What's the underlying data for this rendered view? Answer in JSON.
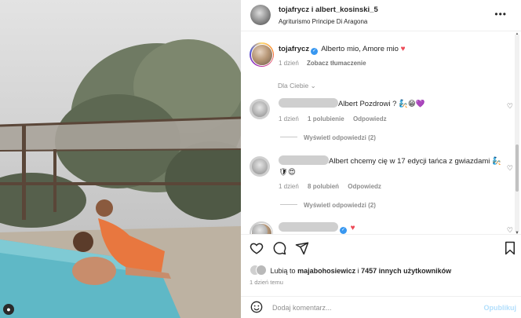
{
  "post": {
    "author_header": "tojafrycz i albert_kosinski_5",
    "location": "Agriturismo Principe Di Aragona",
    "more_label": "•••"
  },
  "caption": {
    "username": "tojafrycz",
    "text": "Alberto mio, Amore mio",
    "heart": "♥",
    "time": "1 dzień",
    "translate_label": "Zobacz tłumaczenie"
  },
  "sort_label": "Dla Ciebie",
  "comments": [
    {
      "text": "Albert Pozdrowi ?",
      "emoji": "🧞😁💜",
      "time": "1 dzień",
      "likes": "1 polubienie",
      "reply_label": "Odpowiedz",
      "replies_label": "Wyświetl odpowiedzi (2)"
    },
    {
      "text": "Albert chcemy cię w 17 edycji tańca z gwiazdami",
      "emoji": "🧞🛡😍",
      "time": "1 dzień",
      "likes": "8 polubień",
      "reply_label": "Odpowiedz",
      "replies_label": "Wyświetl odpowiedzi (2)"
    },
    {
      "heart": "♥"
    }
  ],
  "likes_summary": {
    "prefix": "Lubią to",
    "user": "majabohosiewicz",
    "middle": "i",
    "count": "7457 innych użytkowników"
  },
  "post_date": "1 dzień temu",
  "comment_box": {
    "placeholder": "Dodaj komentarz...",
    "publish_label": "Opublikuj"
  },
  "colors": {
    "verified": "#3897f0",
    "heart": "#ed4956",
    "publish": "#b2dffc",
    "muted_text": "#8e8e8e"
  },
  "icons": [
    "heart-icon",
    "comment-icon",
    "share-icon",
    "bookmark-icon",
    "emoji-icon",
    "verified-icon",
    "more-icon",
    "chevron-down-icon"
  ]
}
